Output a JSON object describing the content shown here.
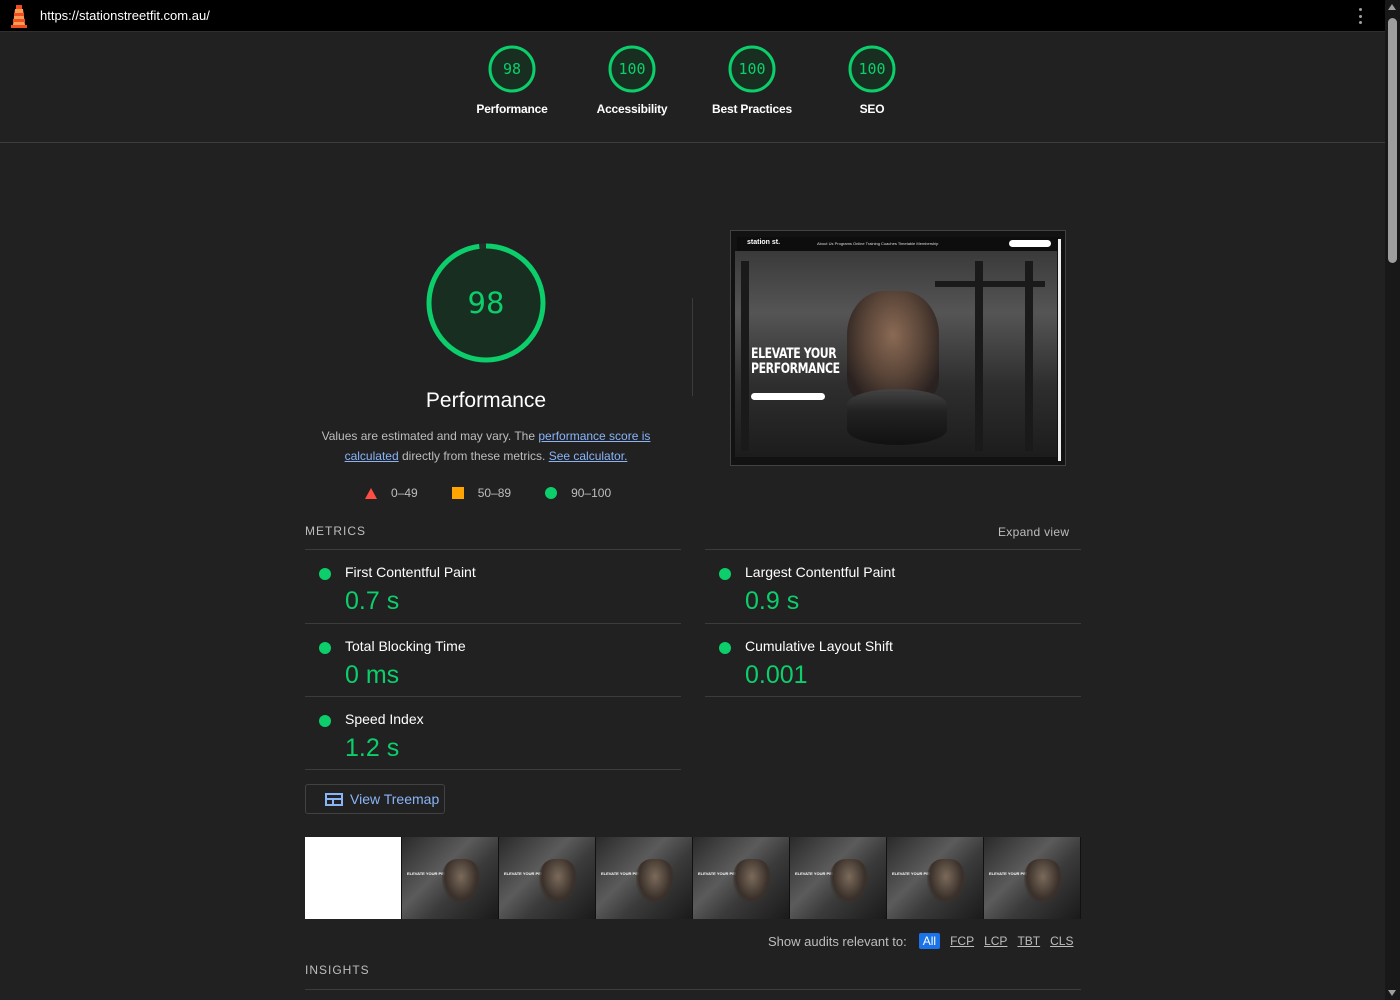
{
  "browser": {
    "url": "https://stationstreetfit.com.au/"
  },
  "colors": {
    "pass": "#0cce6b",
    "average": "#ffa400",
    "fail": "#ff4e42",
    "link": "#8ab4f8"
  },
  "categories": [
    {
      "score": "98",
      "label": "Performance",
      "value": 98
    },
    {
      "score": "100",
      "label": "Accessibility",
      "value": 100
    },
    {
      "score": "100",
      "label": "Best Practices",
      "value": 100
    },
    {
      "score": "100",
      "label": "SEO",
      "value": 100
    }
  ],
  "performance": {
    "score": "98",
    "value": 98,
    "title": "Performance",
    "desc_prefix": "Values are estimated and may vary. The ",
    "desc_link1": "performance score is calculated",
    "desc_middle": " directly from these metrics. ",
    "desc_link2": "See calculator."
  },
  "legend": [
    {
      "range": "0–49",
      "shape": "triangle"
    },
    {
      "range": "50–89",
      "shape": "square"
    },
    {
      "range": "90–100",
      "shape": "circle"
    }
  ],
  "screenshot": {
    "logo": "station st.",
    "nav_links": "About Us   Programs   Online Training   Coaches   Timetable   Membership",
    "hero_title_1": "ELEVATE YOUR",
    "hero_title_2": "PERFORMANCE"
  },
  "metrics": {
    "heading": "METRICS",
    "expand": "Expand view",
    "items": [
      {
        "name": "First Contentful Paint",
        "value": "0.7 s"
      },
      {
        "name": "Largest Contentful Paint",
        "value": "0.9 s"
      },
      {
        "name": "Total Blocking Time",
        "value": "0 ms"
      },
      {
        "name": "Cumulative Layout Shift",
        "value": "0.001"
      },
      {
        "name": "Speed Index",
        "value": "1.2 s"
      }
    ]
  },
  "treemap": {
    "label": "View Treemap"
  },
  "filmstrip": {
    "frame_text": "ELEVATE YOUR PERFORMANCE"
  },
  "audits": {
    "label": "Show audits relevant to:",
    "filters": [
      "All",
      "FCP",
      "LCP",
      "TBT",
      "CLS"
    ]
  },
  "insights": {
    "heading": "INSIGHTS"
  }
}
